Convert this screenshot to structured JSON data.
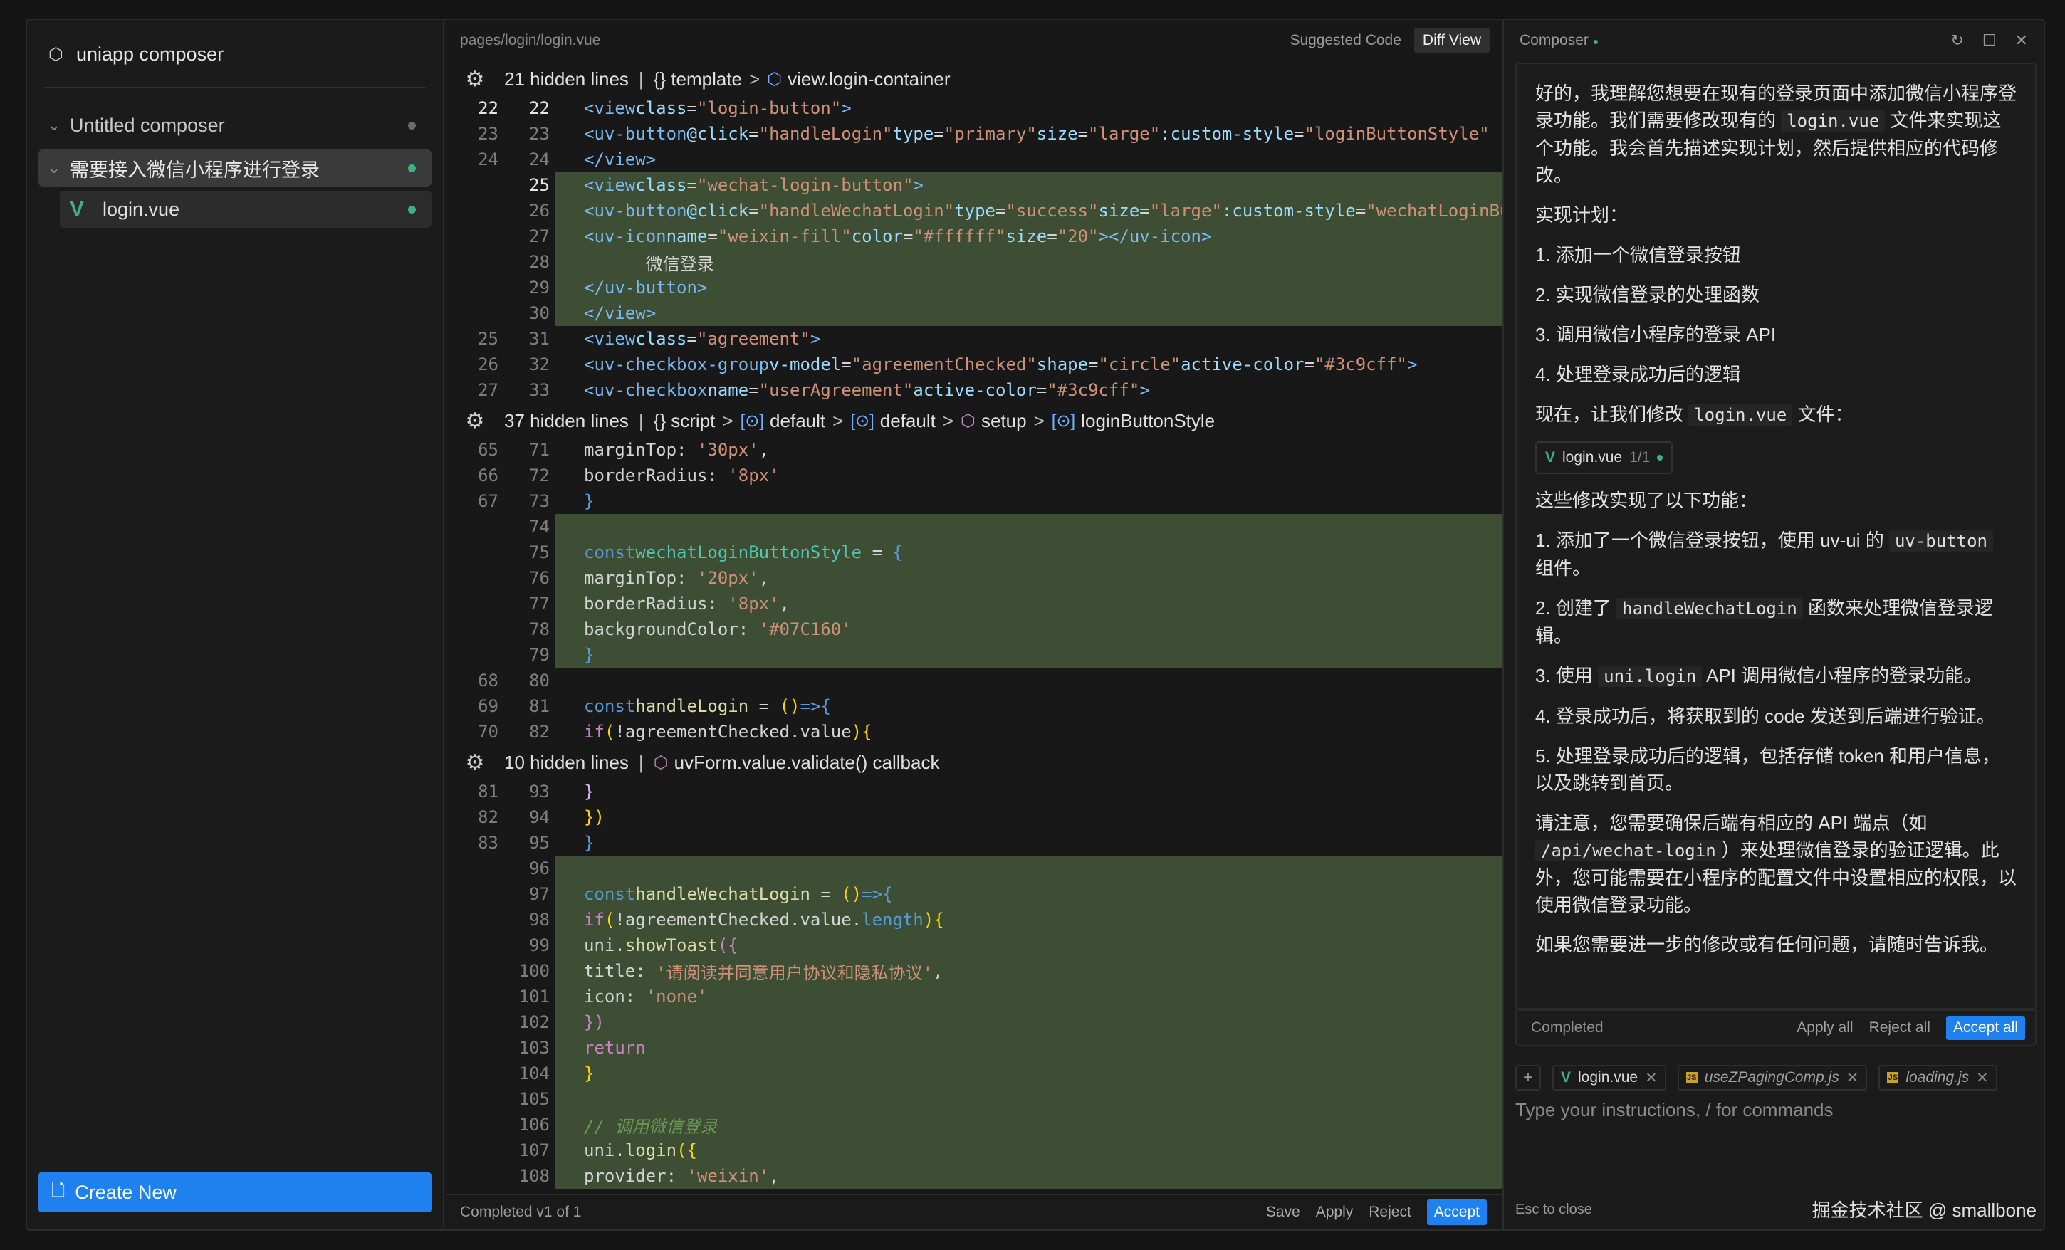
{
  "sidebar": {
    "app_title": "uniapp composer",
    "items": [
      {
        "label": "Untitled composer",
        "dot_color": "#6b6b6b"
      },
      {
        "label": "需要接入微信小程序进行登录",
        "dot_color": "#3fb27f"
      }
    ],
    "file": {
      "label": "login.vue",
      "dot_color": "#3fb27f"
    },
    "create_label": "Create New"
  },
  "editor": {
    "path": "pages/login/login.vue",
    "suggested_label": "Suggested Code",
    "diff_label": "Diff View",
    "hidden1": {
      "text": "21 hidden lines",
      "crumbs": [
        "{} template",
        "view.login-container"
      ]
    },
    "hidden2": {
      "text": "37 hidden lines",
      "crumbs": [
        "{} script",
        "default",
        "default",
        "setup",
        "loginButtonStyle"
      ]
    },
    "hidden3": {
      "text": "10 hidden lines",
      "crumbs": [
        "uvForm.value.validate() callback"
      ]
    },
    "footer_status": "Completed  v1 of 1",
    "footer_save": "Save",
    "footer_apply": "Apply",
    "footer_reject": "Reject",
    "footer_accept": "Accept"
  },
  "composer": {
    "title": "Composer",
    "p1a": "好的，我理解您想要在现有的登录页面中添加微信小程序登录功能。我们需要修改现有的 ",
    "p1code": "login.vue",
    "p1b": " 文件来实现这个功能。我会首先描述实现计划，然后提供相应的代码修改。",
    "plan_title": "实现计划：",
    "plan": [
      "1. 添加一个微信登录按钮",
      "2. 实现微信登录的处理函数",
      "3. 调用微信小程序的登录 API",
      "4. 处理登录成功后的逻辑"
    ],
    "now_a": "现在，让我们修改 ",
    "now_code": "login.vue",
    "now_b": " 文件：",
    "chip_name": "login.vue",
    "chip_count": "1/1",
    "done_title": "这些修改实现了以下功能：",
    "f1a": "1. 添加了一个微信登录按钮，使用 uv-ui 的 ",
    "f1code": "uv-button",
    "f1b": " 组件。",
    "f2a": "2. 创建了 ",
    "f2code": "handleWechatLogin",
    "f2b": " 函数来处理微信登录逻辑。",
    "f3a": "3. 使用 ",
    "f3code": "uni.login",
    "f3b": " API 调用微信小程序的登录功能。",
    "f4": "4. 登录成功后，将获取到的 code 发送到后端进行验证。",
    "f5": "5. 处理登录成功后的逻辑，包括存储 token 和用户信息，以及跳转到首页。",
    "note_a": "请注意，您需要确保后端有相应的 API 端点（如 ",
    "note_code": "/api/wechat-login",
    "note_b": "）来处理微信登录的验证逻辑。此外，您可能需要在小程序的配置文件中设置相应的权限，以使用微信登录功能。",
    "closing": "如果您需要进一步的修改或有任何问题，请随时告诉我。",
    "status": "Completed",
    "apply_all": "Apply all",
    "reject_all": "Reject all",
    "accept_all": "Accept all",
    "files": [
      "login.vue",
      "useZPagingComp.js",
      "loading.js"
    ],
    "input_placeholder": "Type your instructions, / for commands",
    "esc_label": "Esc to close"
  },
  "watermark": "掘金技术社区 @ smallbone"
}
